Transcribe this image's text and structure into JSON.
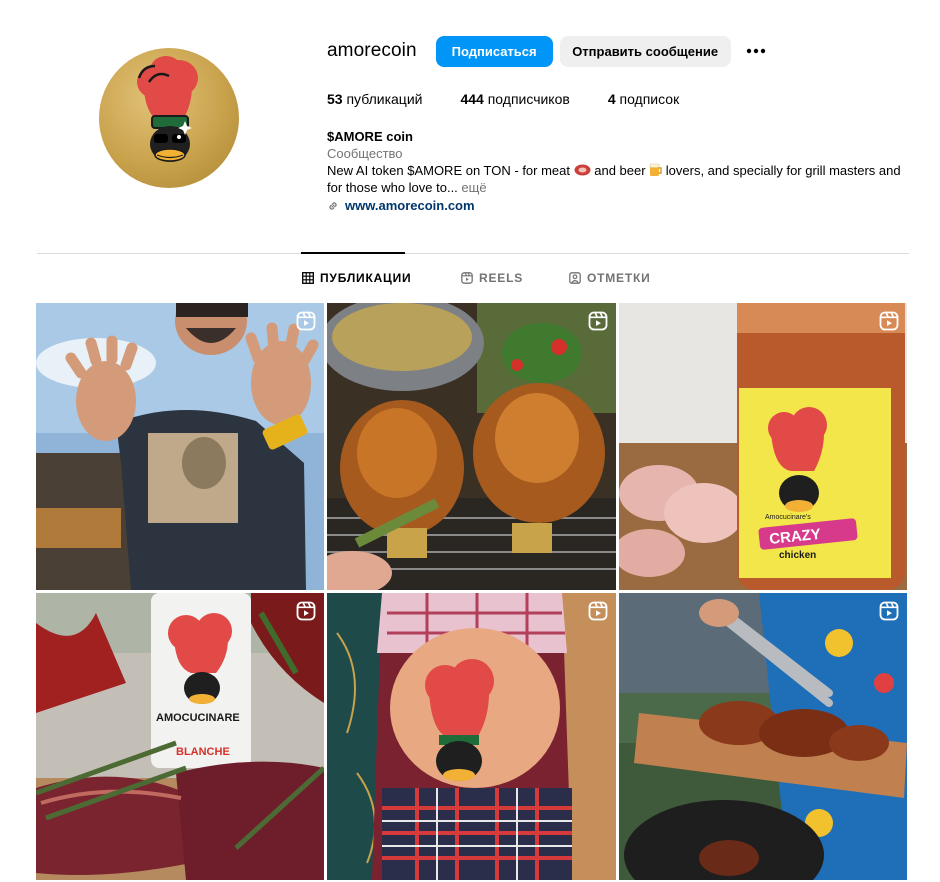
{
  "profile": {
    "username": "amorecoin",
    "follow_label": "Подписаться",
    "message_label": "Отправить сообщение",
    "more_icon": "more-horizontal-icon",
    "stats": {
      "posts_count": "53",
      "posts_label": "публикаций",
      "followers_count": "444",
      "followers_label": "подписчиков",
      "following_count": "4",
      "following_label": "подписок"
    },
    "bio": {
      "name": "$AMORE coin",
      "category": "Сообщество",
      "text_1": "New AI token $AMORE on TON - for meat ",
      "text_2": " and beer ",
      "text_3": " lovers, and specially for grill masters and for those who love to...",
      "more": "ещё",
      "link": "www.amorecoin.com"
    }
  },
  "tabs": [
    {
      "label": "ПУБЛИКАЦИИ",
      "icon": "grid-icon",
      "active": true
    },
    {
      "label": "REELS",
      "icon": "reels-icon",
      "active": false
    },
    {
      "label": "ОТМЕТКИ",
      "icon": "tagged-icon",
      "active": false
    }
  ],
  "posts": [
    {
      "kind": "reel",
      "subject": "man waving"
    },
    {
      "kind": "reel",
      "subject": "beer can chickens"
    },
    {
      "kind": "reel",
      "subject": "spice jar",
      "label_1": "Amocucinare's",
      "label_2": "CRAZY",
      "label_3": "chicken"
    },
    {
      "kind": "reel",
      "subject": "bottle and steaks",
      "label_1": "AMOCUCINARE",
      "label_2": "BLANCHE"
    },
    {
      "kind": "reel",
      "subject": "painted belly"
    },
    {
      "kind": "reel",
      "subject": "chicken on plank"
    }
  ],
  "colors": {
    "primary_button": "#0095f6",
    "secondary_button": "#efefef",
    "link": "#00376b",
    "muted": "#737373",
    "divider": "#dbdbdb",
    "avatar_gold": "#c9a24c"
  }
}
